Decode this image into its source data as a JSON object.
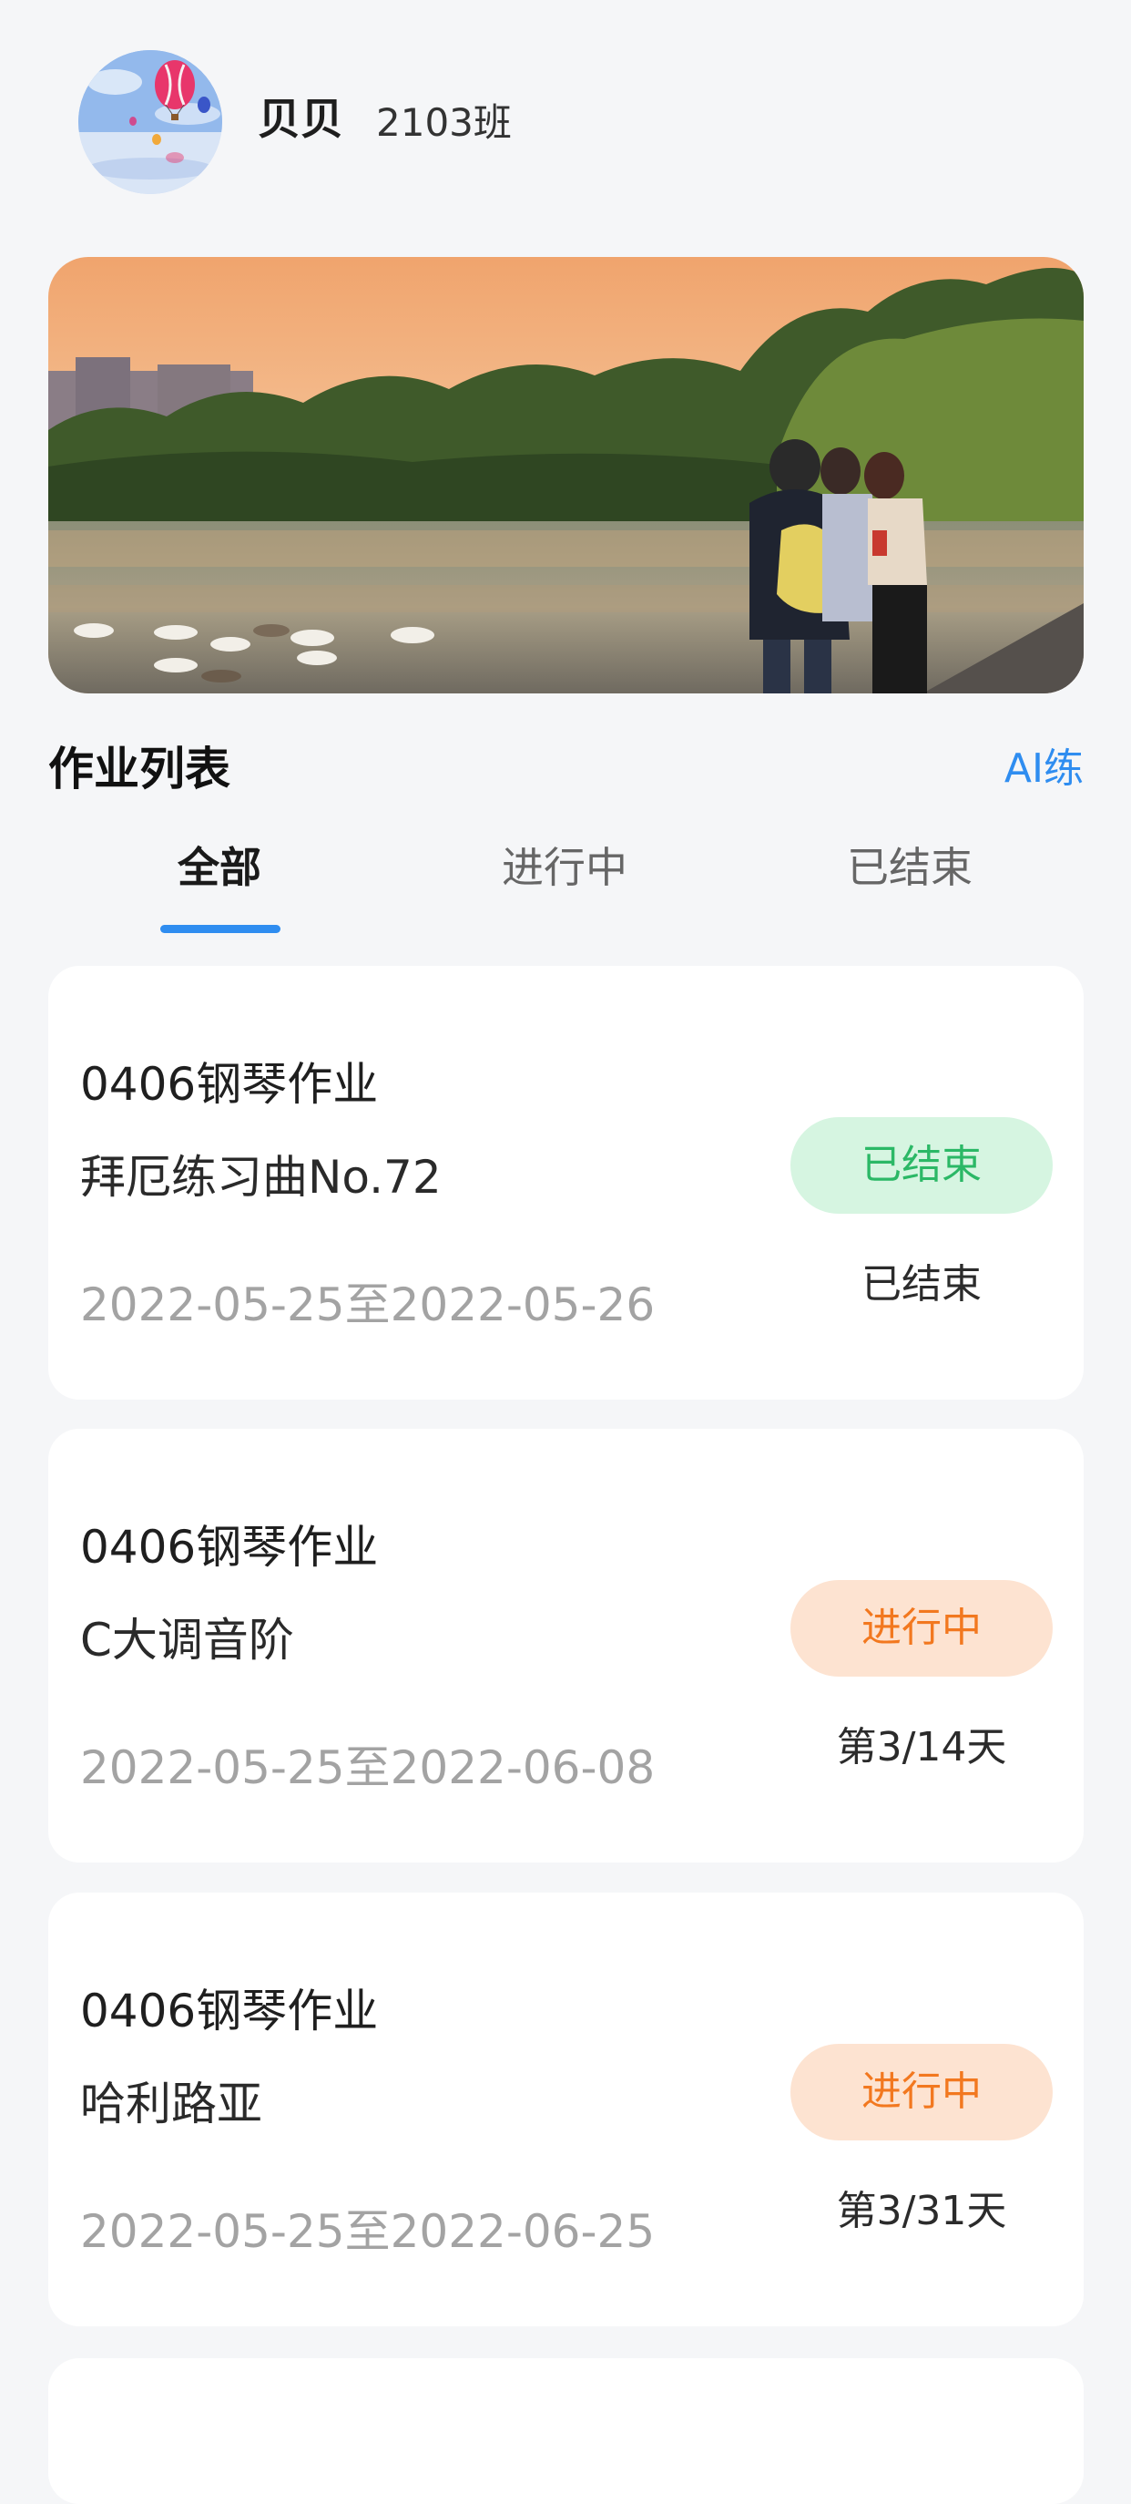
{
  "profile": {
    "name": "贝贝",
    "class_name": "2103班"
  },
  "section": {
    "title": "作业列表",
    "ai_link": "AI练"
  },
  "tabs": [
    {
      "label": "全部",
      "active": true
    },
    {
      "label": "进行中",
      "active": false
    },
    {
      "label": "已结束",
      "active": false
    }
  ],
  "assignments": [
    {
      "title": "0406钢琴作业",
      "subtitle": "拜厄练习曲No.72",
      "date_range": "2022-05-25至2022-05-26",
      "status": "已结束",
      "progress": "已结束"
    },
    {
      "title": "0406钢琴作业",
      "subtitle": "C大调音阶",
      "date_range": "2022-05-25至2022-06-08",
      "status": "进行中",
      "progress": "第3/14天"
    },
    {
      "title": "0406钢琴作业",
      "subtitle": "哈利路亚",
      "date_range": "2022-05-25至2022-06-25",
      "status": "进行中",
      "progress": "第3/31天"
    }
  ],
  "colors": {
    "accent": "#2f8df0",
    "ended_badge_bg": "#d6f5e1",
    "ended_badge_text": "#2bb866",
    "ongoing_badge_bg": "#fde3d1",
    "ongoing_badge_text": "#f2781f"
  }
}
